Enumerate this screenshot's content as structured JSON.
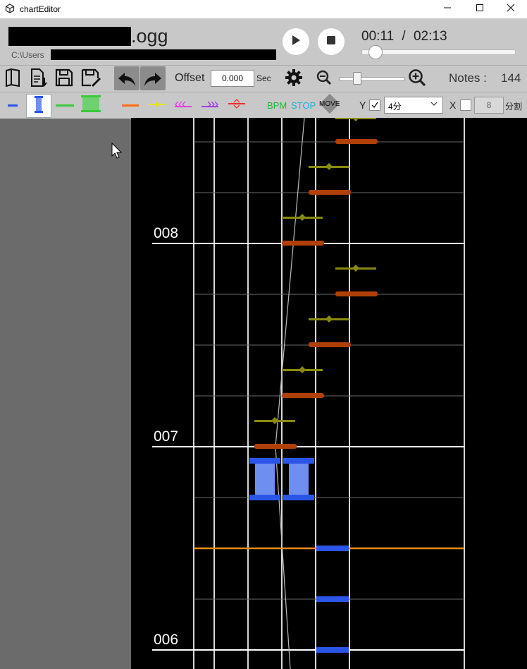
{
  "window": {
    "title": "chartEditor",
    "app_icon": "unity-icon",
    "minimize_icon": "minimize-icon",
    "maximize_icon": "maximize-icon",
    "close_icon": "close-icon"
  },
  "file": {
    "name_suffix": ".ogg",
    "path_prefix": "C:\\Users"
  },
  "playback": {
    "current_time": "00:11",
    "separator": "/",
    "total_time": "02:13",
    "progress": 0.085
  },
  "toolbar": {
    "offset_label": "Offset",
    "offset_value": "0.000",
    "offset_unit": "Sec",
    "notes_label": "Notes :",
    "notes_count": "144"
  },
  "note_toolbar": {
    "bpm_label": "BPM",
    "stop_label": "STOP",
    "move_label": "MOVE",
    "y_label": "Y",
    "y_checked": true,
    "y_division_value": "4分",
    "x_label": "X",
    "x_checked": false,
    "x_division_value": "8",
    "division_label": "分割"
  },
  "chart": {
    "measure_labels": [
      "008",
      "007",
      "006"
    ],
    "colors": {
      "tap": "#2a55e8",
      "hold": "#6e8ff0",
      "flick": "#b04008",
      "slide": "#8a8a10",
      "bpm_line": "#ff8c1a"
    }
  }
}
